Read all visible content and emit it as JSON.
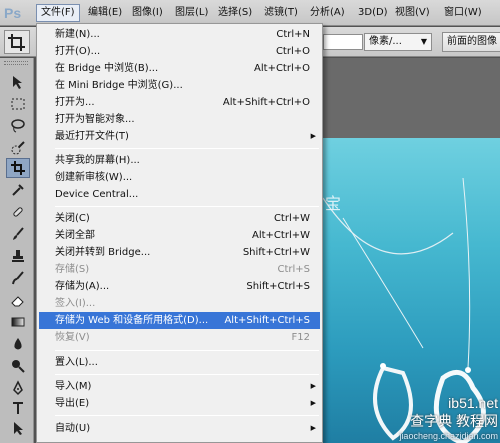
{
  "app": {
    "logo": "Ps"
  },
  "menubar": {
    "items": [
      {
        "label": "文件(F)",
        "active": true
      },
      {
        "label": "编辑(E)"
      },
      {
        "label": "图像(I)"
      },
      {
        "label": "图层(L)"
      },
      {
        "label": "选择(S)"
      },
      {
        "label": "滤镜(T)"
      },
      {
        "label": "分析(A)"
      },
      {
        "label": "3D(D)"
      },
      {
        "label": "视图(V)"
      },
      {
        "label": "窗口(W)"
      }
    ]
  },
  "options_bar": {
    "unit_select": "像素/...",
    "front_image_button": "前面的图像"
  },
  "file_menu": {
    "items": [
      {
        "label": "新建(N)...",
        "shortcut": "Ctrl+N"
      },
      {
        "label": "打开(O)...",
        "shortcut": "Ctrl+O"
      },
      {
        "label": "在 Bridge 中浏览(B)...",
        "shortcut": "Alt+Ctrl+O"
      },
      {
        "label": "在 Mini Bridge 中浏览(G)...",
        "shortcut": ""
      },
      {
        "label": "打开为...",
        "shortcut": "Alt+Shift+Ctrl+O"
      },
      {
        "label": "打开为智能对象...",
        "shortcut": ""
      },
      {
        "label": "最近打开文件(T)",
        "shortcut": "",
        "submenu": true
      },
      {
        "label": "共享我的屏幕(H)...",
        "shortcut": ""
      },
      {
        "label": "创建新审核(W)...",
        "shortcut": ""
      },
      {
        "label": "Device Central...",
        "shortcut": ""
      },
      {
        "label": "关闭(C)",
        "shortcut": "Ctrl+W"
      },
      {
        "label": "关闭全部",
        "shortcut": "Alt+Ctrl+W"
      },
      {
        "label": "关闭并转到 Bridge...",
        "shortcut": "Shift+Ctrl+W"
      },
      {
        "label": "存储(S)",
        "shortcut": "Ctrl+S",
        "disabled": true
      },
      {
        "label": "存储为(A)...",
        "shortcut": "Shift+Ctrl+S"
      },
      {
        "label": "签入(I)...",
        "shortcut": "",
        "disabled": true
      },
      {
        "label": "存储为 Web 和设备所用格式(D)...",
        "shortcut": "Alt+Shift+Ctrl+S",
        "highlighted": true
      },
      {
        "label": "恢复(V)",
        "shortcut": "F12",
        "disabled": true
      },
      {
        "label": "置入(L)...",
        "shortcut": ""
      },
      {
        "label": "导入(M)",
        "shortcut": "",
        "submenu": true
      },
      {
        "label": "导出(E)",
        "shortcut": "",
        "submenu": true
      },
      {
        "label": "自动(U)",
        "shortcut": "",
        "submenu": true
      }
    ]
  },
  "document": {
    "brand_text": "宝"
  },
  "watermark": {
    "main": "查字典 教程网",
    "site": "ib51.net",
    "domain": "jiaocheng.chazidian.com"
  },
  "colors": {
    "highlight": "#3875d7",
    "canvas_sky": "#46b8d0",
    "menubar": "#d0d0d0"
  }
}
